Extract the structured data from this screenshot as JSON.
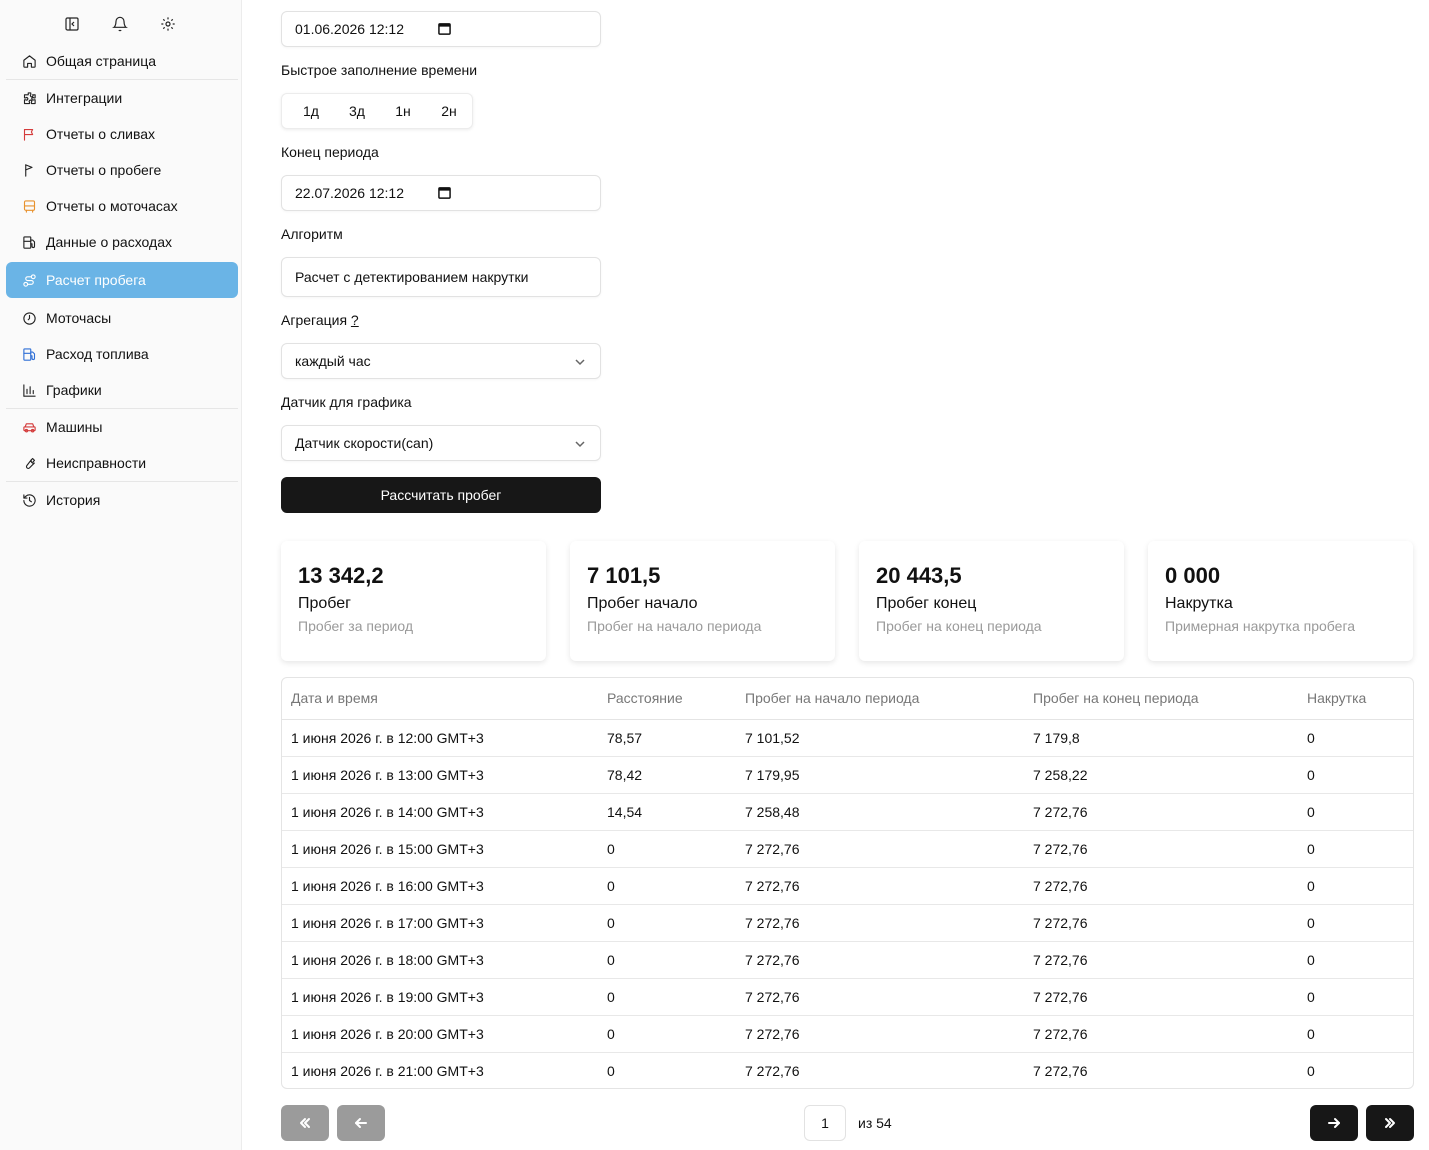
{
  "sidebar": {
    "items": [
      {
        "label": "Общая страница",
        "icon": "home-icon",
        "color": "#222222"
      },
      {
        "label": "Интеграции",
        "icon": "puzzle-icon",
        "color": "#222222"
      },
      {
        "label": "Отчеты о сливах",
        "icon": "flag-icon",
        "color": "#d43b3b"
      },
      {
        "label": "Отчеты о пробеге",
        "icon": "flag-small-icon",
        "color": "#222222"
      },
      {
        "label": "Отчеты о моточасах",
        "icon": "bus-icon",
        "color": "#e8922e"
      },
      {
        "label": "Данные о расходах",
        "icon": "fuel-icon",
        "color": "#222222"
      },
      {
        "label": "Расчет пробега",
        "icon": "route-icon",
        "color": "#ffffff",
        "active": true
      },
      {
        "label": "Моточасы",
        "icon": "clock-icon",
        "color": "#222222"
      },
      {
        "label": "Расход топлива",
        "icon": "fuel-blue-icon",
        "color": "#2f6fd6"
      },
      {
        "label": "Графики",
        "icon": "bar-chart-icon",
        "color": "#222222"
      },
      {
        "label": "Машины",
        "icon": "car-icon",
        "color": "#d43b3b"
      },
      {
        "label": "Неисправности",
        "icon": "wrench-icon",
        "color": "#222222"
      },
      {
        "label": "История",
        "icon": "history-icon",
        "color": "#222222"
      }
    ]
  },
  "form": {
    "start_value": "01.06.2026 12:12",
    "quick_label": "Быстрое заполнение времени",
    "quick_options": [
      "1д",
      "3д",
      "1н",
      "2н"
    ],
    "end_label": "Конец периода",
    "end_value": "22.07.2026 12:12",
    "algorithm_label": "Алгоритм",
    "algorithm_value": "Расчет с детектированием накрутки",
    "aggregation_label": "Агрегация",
    "aggregation_hint": "?",
    "aggregation_value": "каждый час",
    "sensor_label": "Датчик для графика",
    "sensor_value": "Датчик скорости(can)",
    "calc_button": "Рассчитать пробег"
  },
  "cards": [
    {
      "value": "13 342,2",
      "name": "Пробег",
      "sub": "Пробег за период"
    },
    {
      "value": "7 101,5",
      "name": "Пробег начало",
      "sub": "Пробег на начало периода"
    },
    {
      "value": "20 443,5",
      "name": "Пробег конец",
      "sub": "Пробег на конец периода"
    },
    {
      "value": "0 000",
      "name": "Накрутка",
      "sub": "Примерная накрутка пробега"
    }
  ],
  "table": {
    "headers": [
      "Дата и время",
      "Расстояние",
      "Пробег на начало периода",
      "Пробег на конец периода",
      "Накрутка"
    ],
    "rows": [
      [
        "1 июня 2026 г. в 12:00 GMT+3",
        "78,57",
        "7 101,52",
        "7 179,8",
        "0"
      ],
      [
        "1 июня 2026 г. в 13:00 GMT+3",
        "78,42",
        "7 179,95",
        "7 258,22",
        "0"
      ],
      [
        "1 июня 2026 г. в 14:00 GMT+3",
        "14,54",
        "7 258,48",
        "7 272,76",
        "0"
      ],
      [
        "1 июня 2026 г. в 15:00 GMT+3",
        "0",
        "7 272,76",
        "7 272,76",
        "0"
      ],
      [
        "1 июня 2026 г. в 16:00 GMT+3",
        "0",
        "7 272,76",
        "7 272,76",
        "0"
      ],
      [
        "1 июня 2026 г. в 17:00 GMT+3",
        "0",
        "7 272,76",
        "7 272,76",
        "0"
      ],
      [
        "1 июня 2026 г. в 18:00 GMT+3",
        "0",
        "7 272,76",
        "7 272,76",
        "0"
      ],
      [
        "1 июня 2026 г. в 19:00 GMT+3",
        "0",
        "7 272,76",
        "7 272,76",
        "0"
      ],
      [
        "1 июня 2026 г. в 20:00 GMT+3",
        "0",
        "7 272,76",
        "7 272,76",
        "0"
      ],
      [
        "1 июня 2026 г. в 21:00 GMT+3",
        "0",
        "7 272,76",
        "7 272,76",
        "0"
      ]
    ]
  },
  "pagination": {
    "current_page": "1",
    "total_label": "из 54"
  }
}
